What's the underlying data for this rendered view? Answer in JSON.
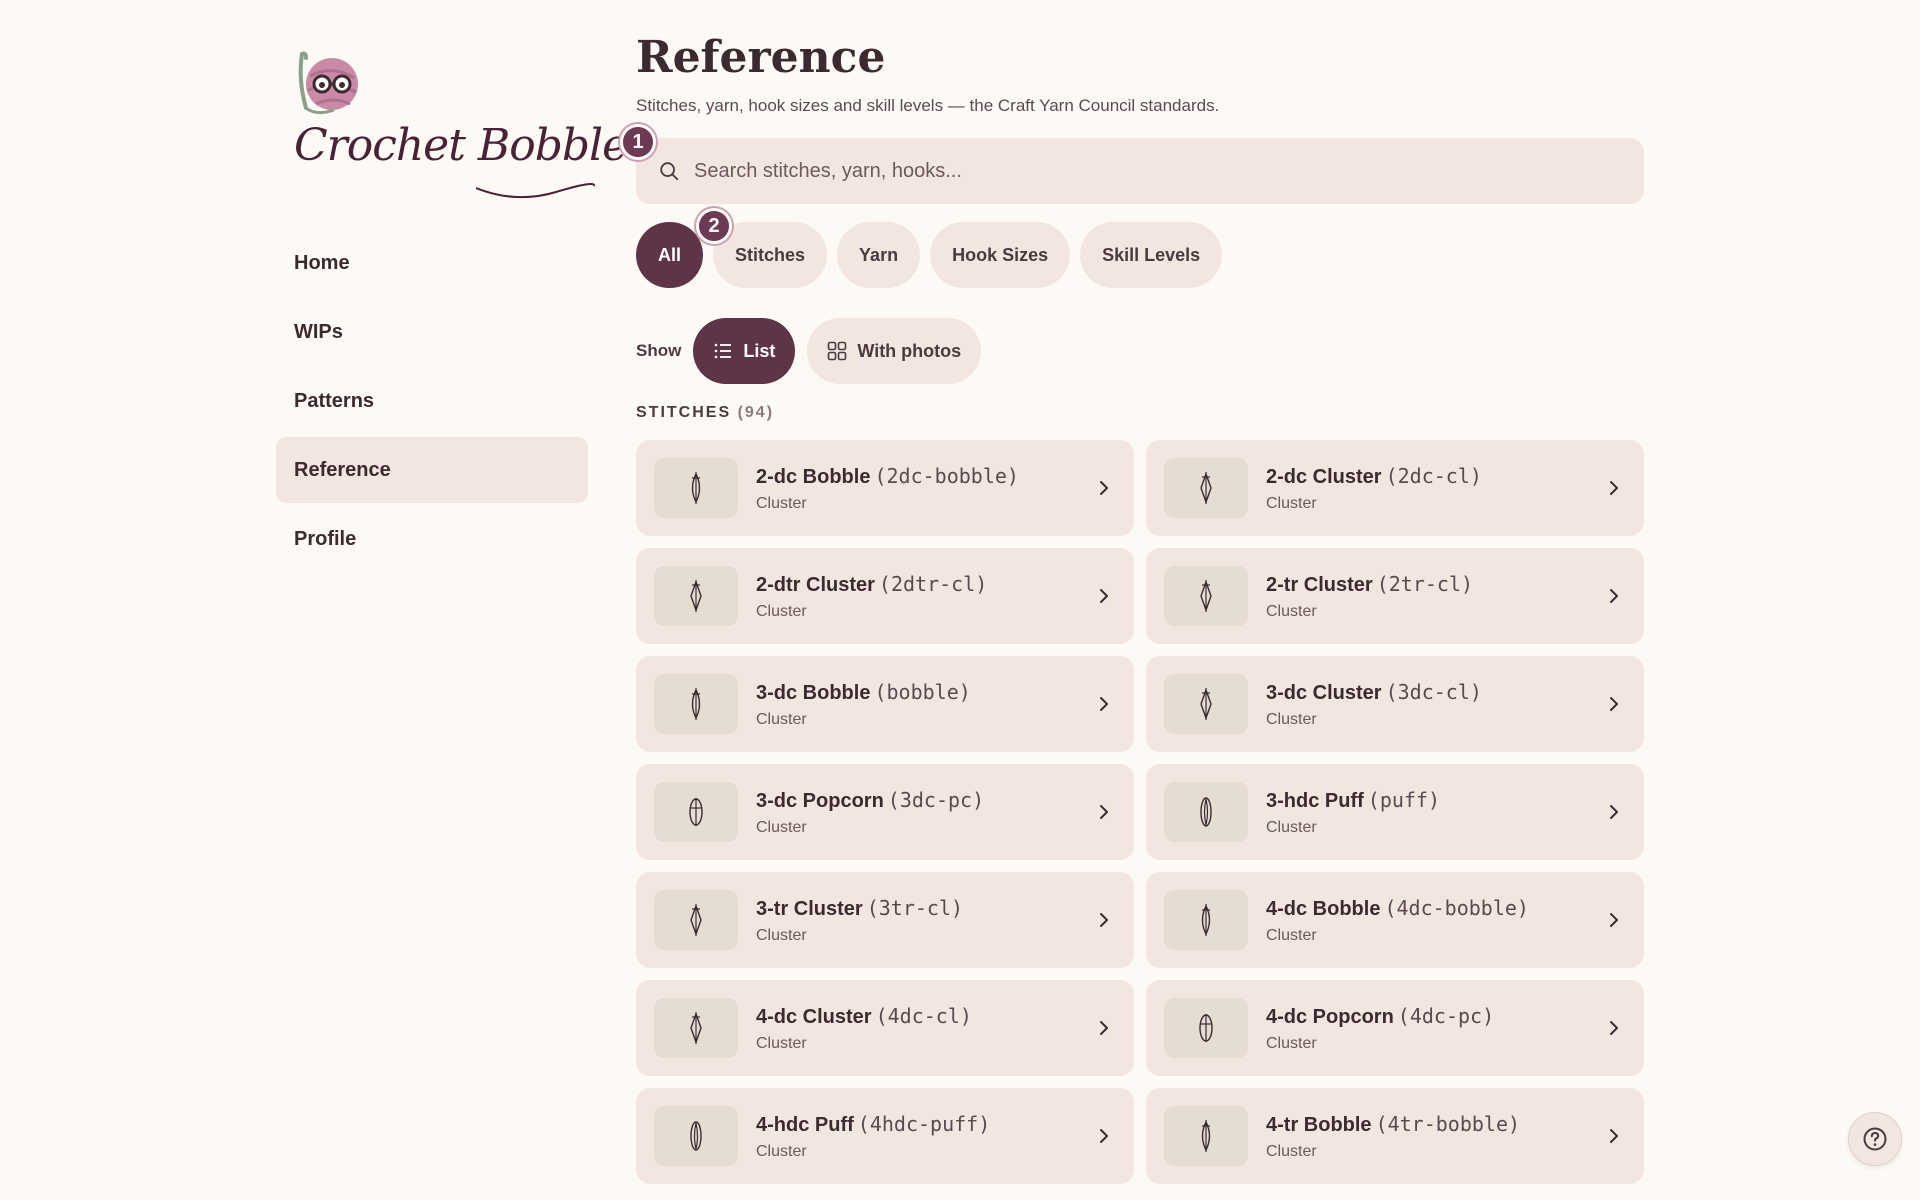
{
  "brand": {
    "name": "Crochet Bobble"
  },
  "nav": {
    "items": [
      {
        "label": "Home"
      },
      {
        "label": "WIPs"
      },
      {
        "label": "Patterns"
      },
      {
        "label": "Reference"
      },
      {
        "label": "Profile"
      }
    ]
  },
  "page": {
    "title": "Reference",
    "subtitle": "Stitches, yarn, hook sizes and skill levels — the Craft Yarn Council standards."
  },
  "search": {
    "placeholder": "Search stitches, yarn, hooks..."
  },
  "badges": [
    "1",
    "2"
  ],
  "filters": [
    "All",
    "Stitches",
    "Yarn",
    "Hook Sizes",
    "Skill Levels"
  ],
  "view": {
    "label": "Show",
    "list": "List",
    "photos": "With photos"
  },
  "section": {
    "title": "STITCHES",
    "count": "(94)"
  },
  "stitches": [
    {
      "name": "2-dc Bobble",
      "abbr": "(2dc-bobble)",
      "category": "Cluster",
      "icon": "bobble-symbol-icon"
    },
    {
      "name": "2-dc Cluster",
      "abbr": "(2dc-cl)",
      "category": "Cluster",
      "icon": "cluster-symbol-icon"
    },
    {
      "name": "2-dtr Cluster",
      "abbr": "(2dtr-cl)",
      "category": "Cluster",
      "icon": "cluster-symbol-icon"
    },
    {
      "name": "2-tr Cluster",
      "abbr": "(2tr-cl)",
      "category": "Cluster",
      "icon": "cluster-symbol-icon"
    },
    {
      "name": "3-dc Bobble",
      "abbr": "(bobble)",
      "category": "Cluster",
      "icon": "bobble-symbol-icon"
    },
    {
      "name": "3-dc Cluster",
      "abbr": "(3dc-cl)",
      "category": "Cluster",
      "icon": "cluster-symbol-icon"
    },
    {
      "name": "3-dc Popcorn",
      "abbr": "(3dc-pc)",
      "category": "Cluster",
      "icon": "popcorn-symbol-icon"
    },
    {
      "name": "3-hdc Puff",
      "abbr": "(puff)",
      "category": "Cluster",
      "icon": "puff-symbol-icon"
    },
    {
      "name": "3-tr Cluster",
      "abbr": "(3tr-cl)",
      "category": "Cluster",
      "icon": "cluster-symbol-icon"
    },
    {
      "name": "4-dc Bobble",
      "abbr": "(4dc-bobble)",
      "category": "Cluster",
      "icon": "bobble-symbol-icon"
    },
    {
      "name": "4-dc Cluster",
      "abbr": "(4dc-cl)",
      "category": "Cluster",
      "icon": "cluster-symbol-icon"
    },
    {
      "name": "4-dc Popcorn",
      "abbr": "(4dc-pc)",
      "category": "Cluster",
      "icon": "popcorn-symbol-icon"
    },
    {
      "name": "4-hdc Puff",
      "abbr": "(4hdc-puff)",
      "category": "Cluster",
      "icon": "puff-symbol-icon"
    },
    {
      "name": "4-tr Bobble",
      "abbr": "(4tr-bobble)",
      "category": "Cluster",
      "icon": "bobble-symbol-icon"
    }
  ],
  "colors": {
    "background": "#fdfaf5",
    "card": "#f3e6e0",
    "accent": "#5e3547",
    "badge": "#6d3a55",
    "thumb": "#e6ddd2"
  },
  "help": {
    "icon": "question-circle-icon"
  }
}
